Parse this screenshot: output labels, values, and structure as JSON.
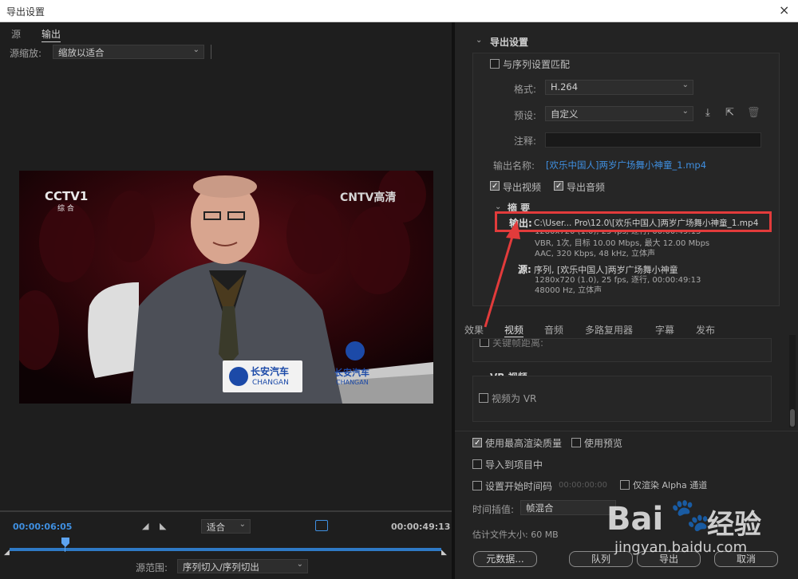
{
  "window": {
    "title": "导出设置",
    "close": "×"
  },
  "left": {
    "tabs": [
      "源",
      "输出"
    ],
    "source_scale_label": "源缩放:",
    "source_scale_value": "缩放以适合",
    "timecode_start": "00:00:06:05",
    "timecode_end": "00:00:49:13",
    "fit_value": "适合",
    "source_range_label": "源范围:",
    "source_range_value": "序列切入/序列切出",
    "video": {
      "channel_logo": "CCTV1",
      "channel_sub": "综 合",
      "cntv": "CNTV高清",
      "sponsor1": "长安汽车",
      "sponsor2": "CHANGAN"
    }
  },
  "export": {
    "section_title": "导出设置",
    "match_sequence": "与序列设置匹配",
    "format_label": "格式:",
    "format_value": "H.264",
    "preset_label": "预设:",
    "preset_value": "自定义",
    "comment_label": "注释:",
    "output_name_label": "输出名称:",
    "output_name_value": "[欢乐中国人]两岁广场舞小神童_1.mp4",
    "export_video": "导出视频",
    "export_audio": "导出音频",
    "summary_title": "摘 要",
    "output_label": "输出:",
    "output_path": "C:\\User... Pro\\12.0\\[欢乐中国人]两岁广场舞小神童_1.mp4",
    "output_lines": [
      "1280x720 (1.0), 25 fps, 逐行, 00:00:49:13",
      "VBR, 1次, 目标 10.00 Mbps, 最大 12.00 Mbps",
      "AAC, 320 Kbps, 48 kHz, 立体声"
    ],
    "source_label": "源:",
    "source_line0": "序列, [欢乐中国人]两岁广场舞小神童",
    "source_lines": [
      "1280x720 (1.0), 25 fps, 逐行, 00:00:49:13",
      "48000 Hz, 立体声"
    ]
  },
  "tabs2": [
    "效果",
    "视频",
    "音频",
    "多路复用器",
    "字幕",
    "发布"
  ],
  "keyframe_label": "关键帧距离:",
  "vr": {
    "title": "VR 视频",
    "video_as_vr": "视频为 VR"
  },
  "bottom": {
    "max_render": "使用最高渲染质量",
    "use_preview": "使用预览",
    "import_project": "导入到项目中",
    "set_start_tc": "设置开始时间码",
    "start_tc_value": "00:00:00:00",
    "alpha_only": "仅渲染 Alpha 通道",
    "interp_label": "时间插值:",
    "interp_value": "帧混合",
    "file_size": "估计文件大小: 60 MB",
    "buttons": [
      "元数据...",
      "队列",
      "导出",
      "取消"
    ]
  },
  "watermark": {
    "brand": "Bai",
    "brand2": "经验",
    "url": "jingyan.baidu.com"
  },
  "colors": {
    "accent": "#3f8fe0",
    "highlight": "#e23b3b",
    "timeline": "#2f7ac6"
  }
}
